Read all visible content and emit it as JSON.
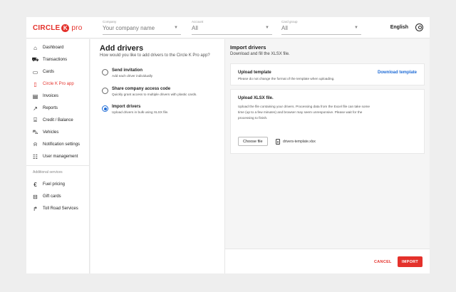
{
  "header": {
    "logo_text": "CIRCLE",
    "logo_k": "K",
    "logo_pro": "pro",
    "company": {
      "label": "Company",
      "value": "Your company name"
    },
    "account": {
      "label": "Account",
      "value": "All"
    },
    "card_group": {
      "label": "Card group",
      "value": "All"
    },
    "language": "English"
  },
  "sidebar": {
    "items": [
      {
        "label": "Dashboard",
        "icon": "home-icon",
        "active": false
      },
      {
        "label": "Transactions",
        "icon": "cart-icon",
        "active": false
      },
      {
        "label": "Cards",
        "icon": "card-icon",
        "active": false
      },
      {
        "label": "Circle K Pro app",
        "icon": "phone-icon",
        "active": true
      },
      {
        "label": "Invoices",
        "icon": "invoice-icon",
        "active": false
      },
      {
        "label": "Reports",
        "icon": "chart-icon",
        "active": false
      },
      {
        "label": "Credit / Balance",
        "icon": "bank-icon",
        "active": false
      },
      {
        "label": "Vehicles",
        "icon": "car-icon",
        "active": false
      },
      {
        "label": "Notification settings",
        "icon": "bell-icon",
        "active": false
      },
      {
        "label": "User management",
        "icon": "users-icon",
        "active": false
      }
    ],
    "section_label": "Additional services",
    "services": [
      {
        "label": "Fuel pricing",
        "icon": "euro-icon"
      },
      {
        "label": "Gift cards",
        "icon": "gift-icon"
      },
      {
        "label": "Toll Road Services",
        "icon": "road-icon"
      }
    ]
  },
  "add_drivers": {
    "title": "Add drivers",
    "subtitle": "How would you like to add drivers to the Circle K Pro app?",
    "options": [
      {
        "title": "Send invitation",
        "desc": "Add each driver individually",
        "selected": false
      },
      {
        "title": "Share company access code",
        "desc": "Quickly grant access to multiple drivers with plastic cards.",
        "selected": false
      },
      {
        "title": "Import drivers",
        "desc": "Upload drivers in bulk using XLSX file.",
        "selected": true
      }
    ]
  },
  "import": {
    "title": "Import drivers",
    "subtitle": "Download and fill the XLSX file.",
    "template_card": {
      "title": "Upload template",
      "text": "Please do not change the format of the template when uploading.",
      "link": "Download template"
    },
    "upload_card": {
      "title": "Upload XLSX file.",
      "text": "Upload the file containing your drivers. Processing data from the Excel file can take some time (up to a few minutes) and browser may seem unresponsive. Please wait for the processing to finish.",
      "button": "Choose file",
      "file_name": "drivers-template.xlsx"
    }
  },
  "footer": {
    "cancel": "CANCEL",
    "import": "IMPORT"
  },
  "colors": {
    "brand_red": "#e4312b",
    "link_blue": "#1e6bd6"
  }
}
